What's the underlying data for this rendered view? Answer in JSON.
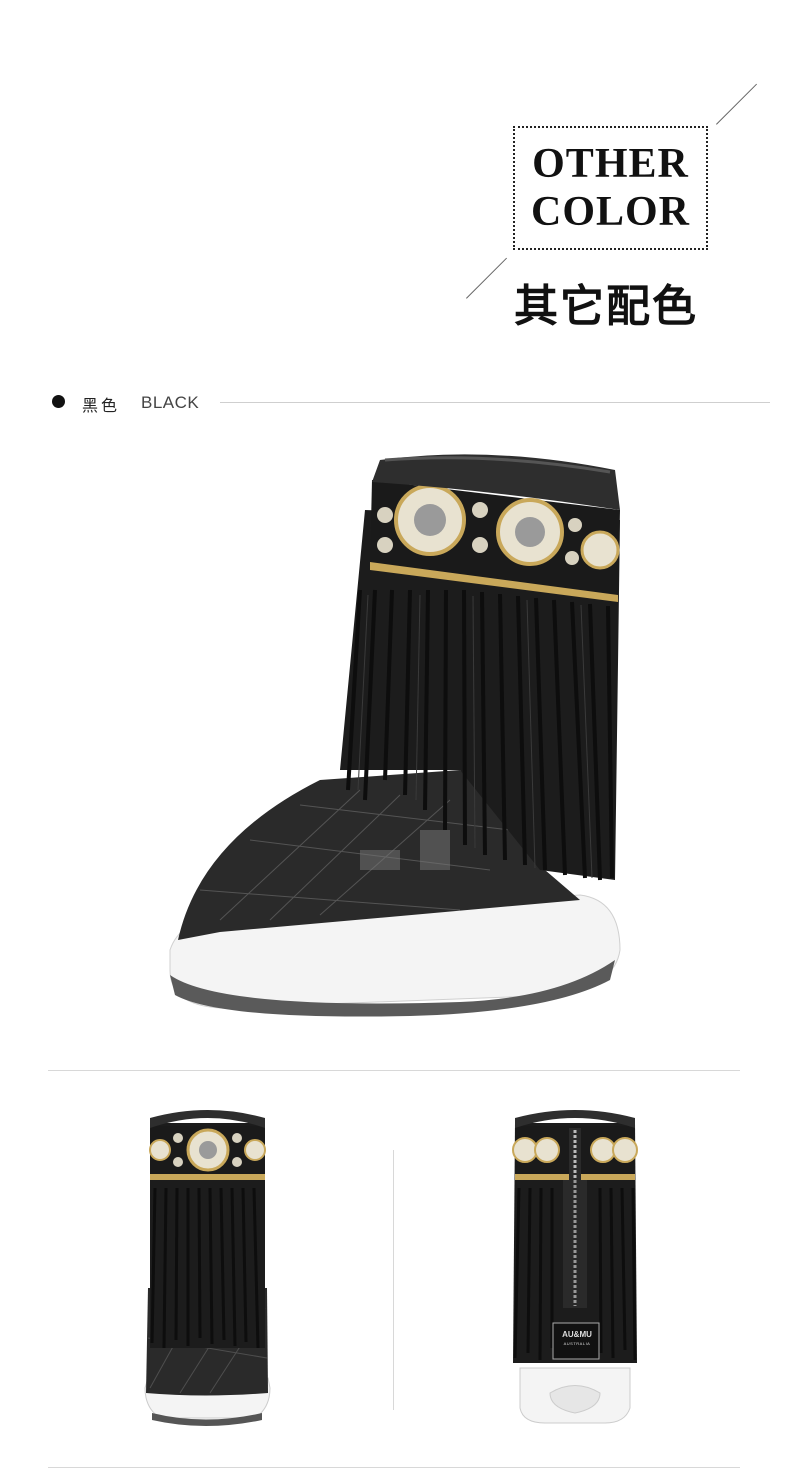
{
  "header": {
    "title_en_line1": "OTHER",
    "title_en_line2": "COLOR",
    "title_cn": "其它配色"
  },
  "color_item": {
    "name_cn": "黑色",
    "name_en": "BLACK"
  },
  "brand_label": {
    "line1": "AU&MU",
    "line2": "AUSTRALIA"
  },
  "colors": {
    "boot_black": "#1a1a1a",
    "sole_white": "#f4f4f4",
    "embroidery_gold": "#c9a85a"
  }
}
